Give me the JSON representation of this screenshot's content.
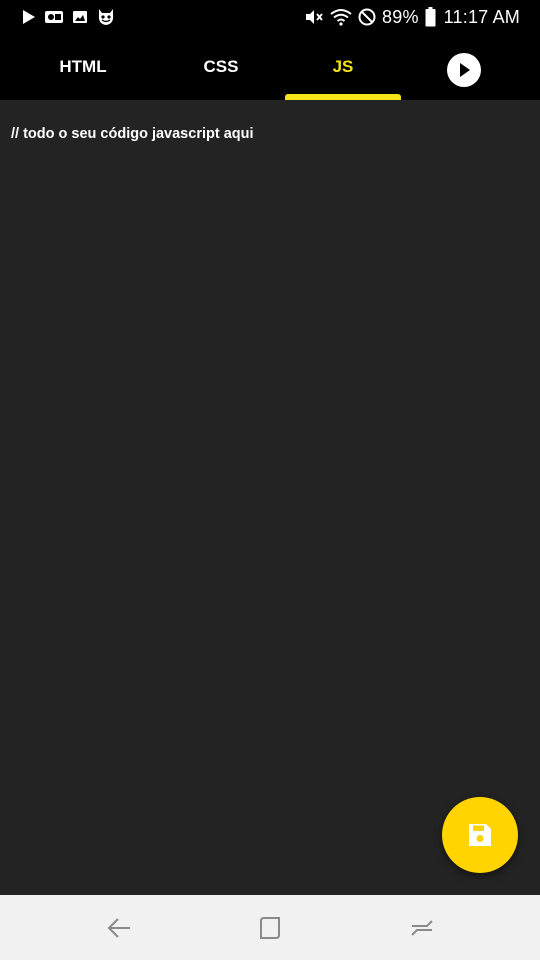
{
  "status_bar": {
    "battery_percent": "89%",
    "time": "11:17 AM",
    "left_icons": [
      "play-store-icon",
      "notification-app-icon",
      "image-icon",
      "devil-face-icon"
    ],
    "right_icons": [
      "mute-icon",
      "wifi-icon",
      "do-not-disturb-icon",
      "battery-icon"
    ]
  },
  "tabs": [
    {
      "label": "HTML",
      "selected": false
    },
    {
      "label": "CSS",
      "selected": false
    },
    {
      "label": "JS",
      "selected": true
    }
  ],
  "run_button": {
    "icon": "play-icon"
  },
  "editor": {
    "code": "// todo o seu código javascript aqui"
  },
  "fab": {
    "icon": "save-icon"
  },
  "nav_bar": {
    "icons": [
      "back-icon",
      "home-icon",
      "recent-apps-icon"
    ]
  },
  "colors": {
    "accent": "#f5e31a",
    "fab": "#ffd400",
    "editor_bg": "#232323",
    "bar_bg": "#000000",
    "nav_bg": "#f1f1f1"
  }
}
